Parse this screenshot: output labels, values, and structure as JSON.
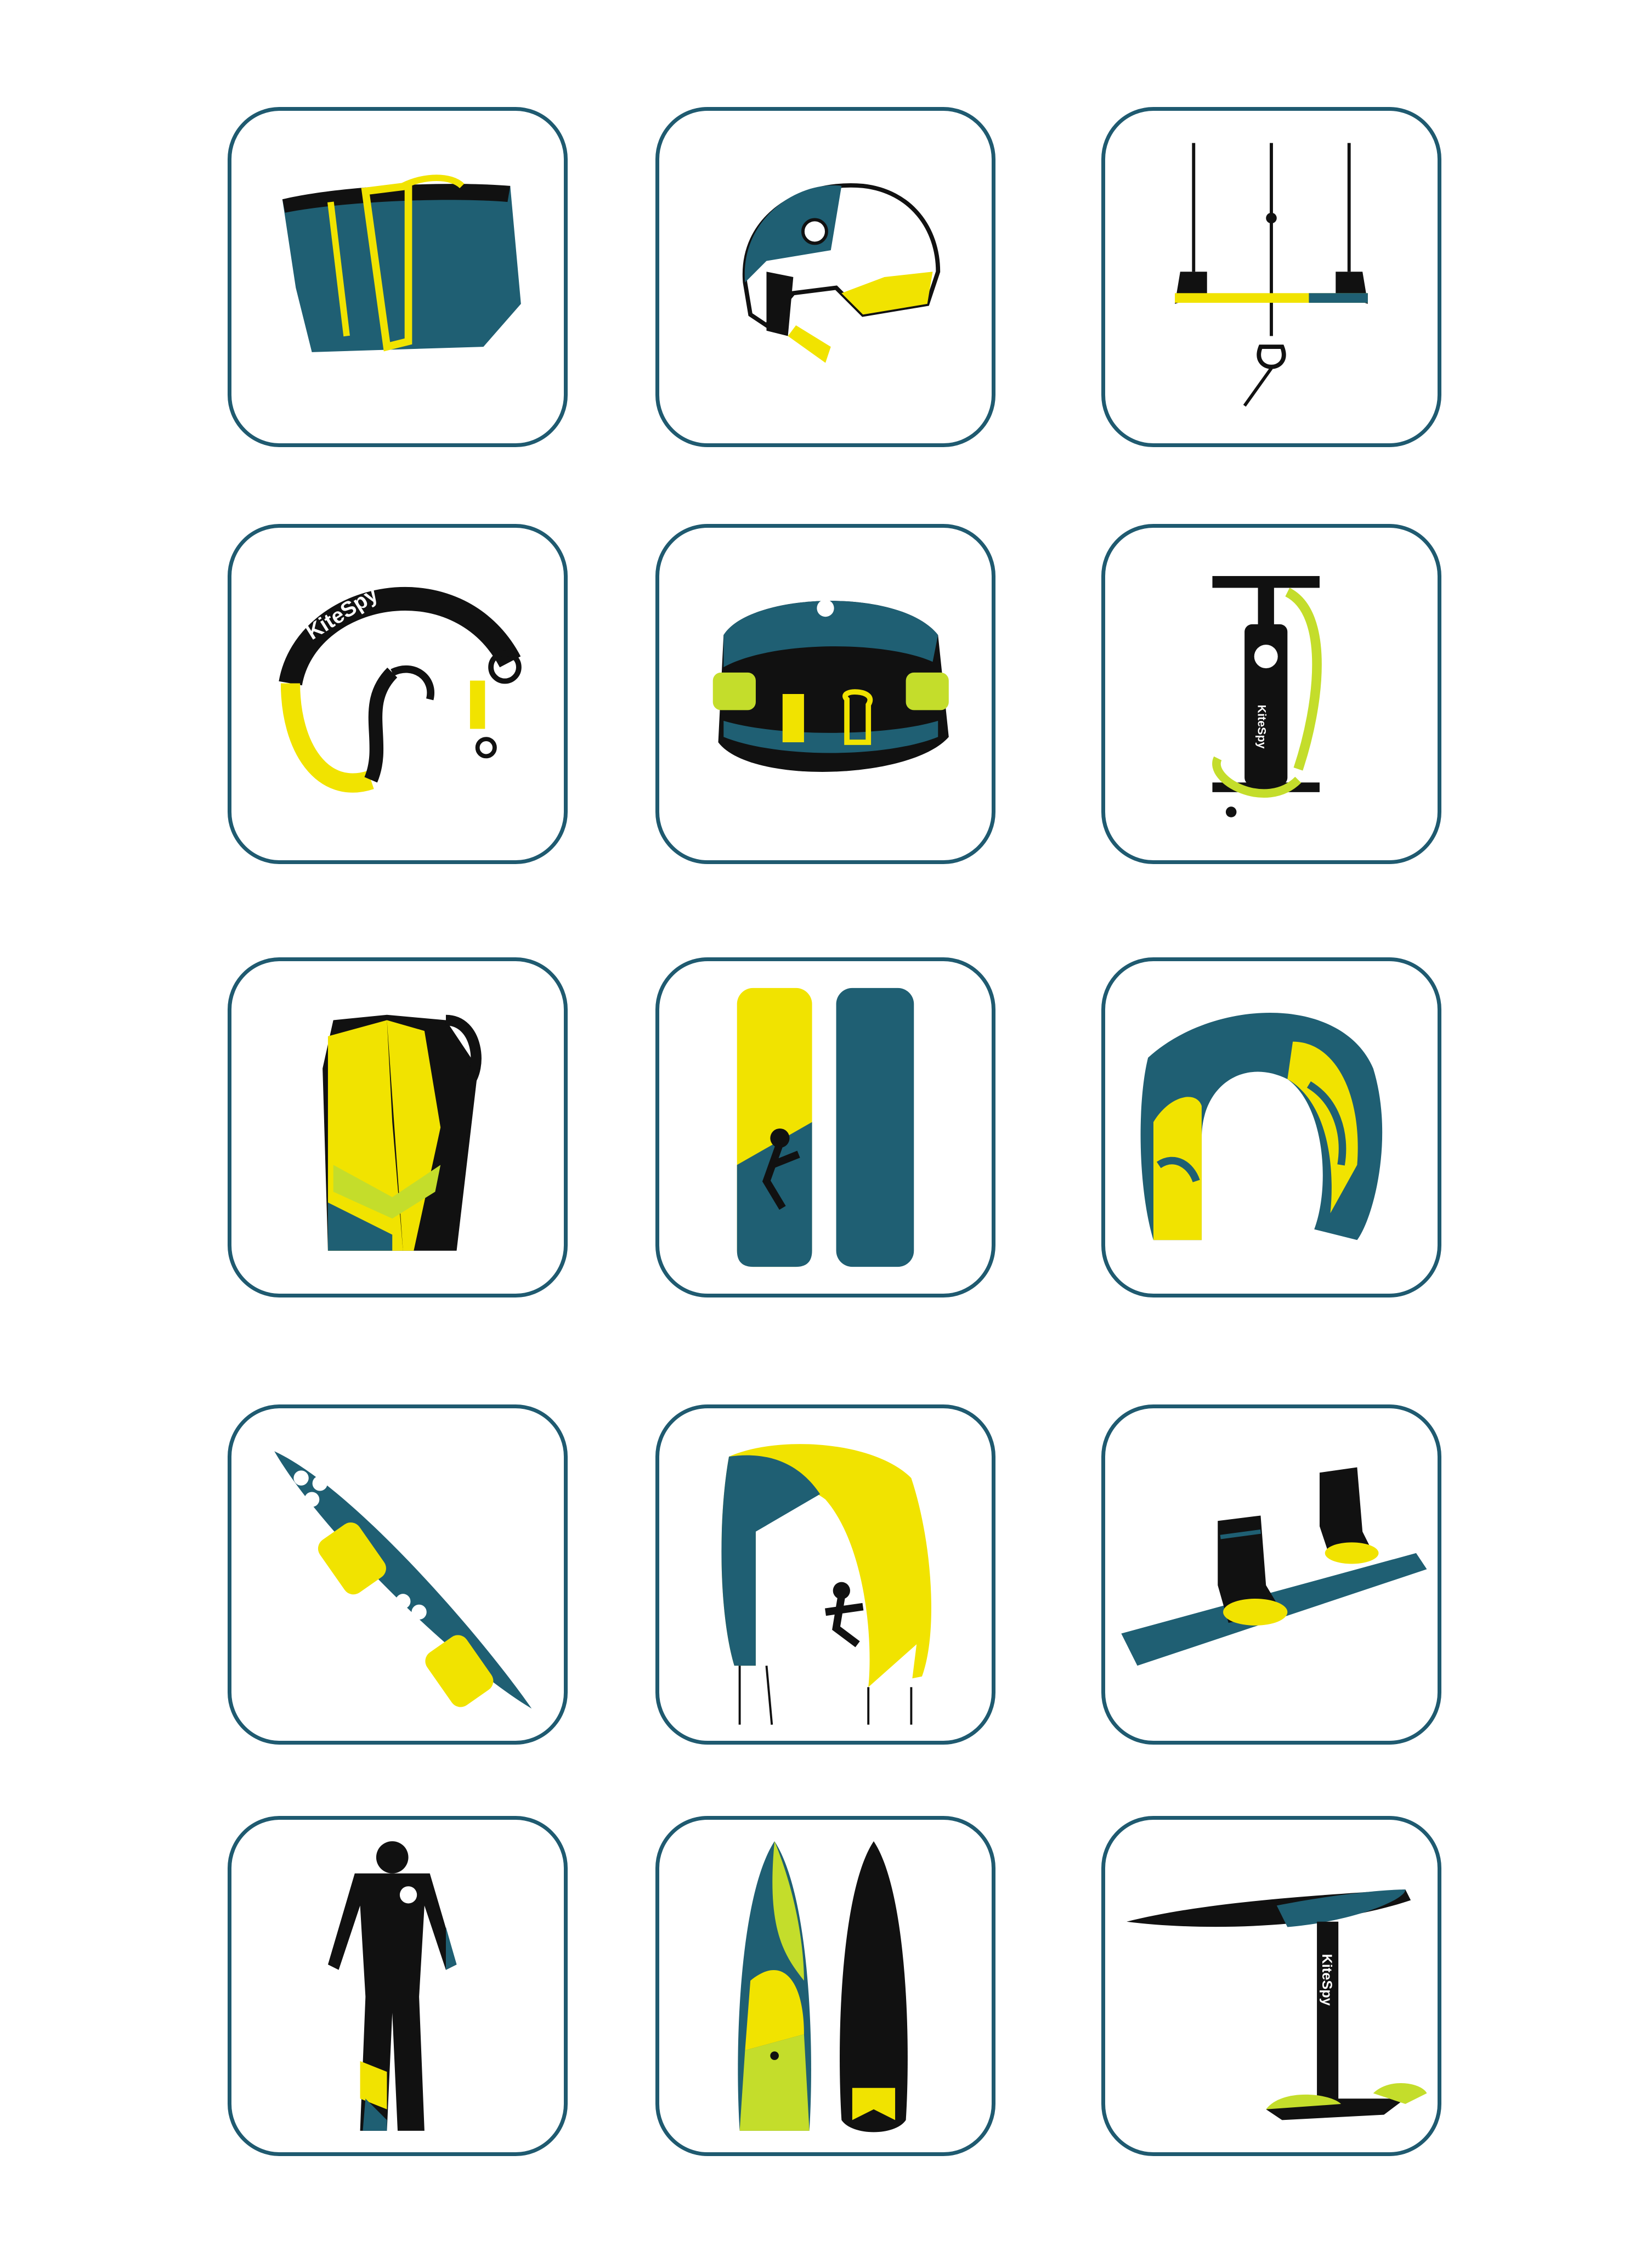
{
  "brand_text": "KiteSpy",
  "colors": {
    "teal": "#1f5f73",
    "yellow": "#f1e300",
    "lime": "#c4dd2b",
    "black": "#111111",
    "border": "#1f5a70"
  },
  "icons": [
    "kite-bag-icon",
    "helmet-icon",
    "control-bar-icon",
    "board-leash-icon",
    "harness-icon",
    "pump-icon",
    "impact-vest-icon",
    "twintip-boards-icon",
    "kite-icon",
    "surfboard-icon",
    "kite-with-rider-icon",
    "wakeboard-boots-icon",
    "wetsuit-icon",
    "surfboards-icon",
    "hydrofoil-icon"
  ]
}
